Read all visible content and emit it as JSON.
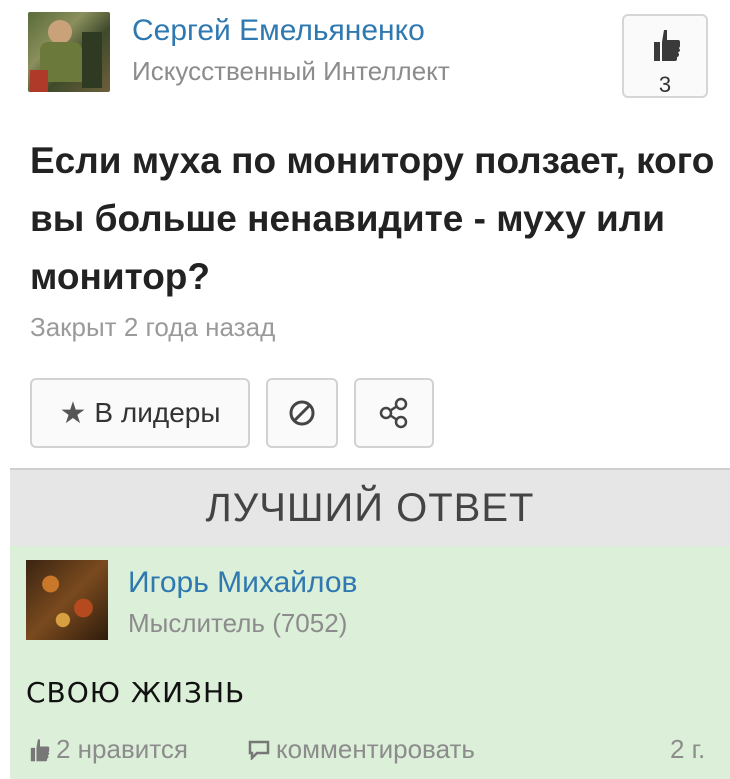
{
  "question": {
    "author_name": "Сергей Емельяненко",
    "author_rank": "Искусственный Интеллект",
    "like_count": "3",
    "title": "Если муха по монитору ползает, кого вы больше ненавидите - муху или монитор?",
    "status": "Закрыт 2 года назад",
    "actions": {
      "leader_label": "В лидеры",
      "leader_icon": "star-icon",
      "block_icon": "block-icon",
      "share_icon": "share-icon"
    }
  },
  "best_answer": {
    "header": "ЛУЧШИЙ ОТВЕТ",
    "author_name": "Игорь Михайлов",
    "author_rank": "Мыслитель (7052)",
    "text": "СВОЮ ЖИЗНЬ",
    "likes_label": "2 нравится",
    "comment_label": "комментировать",
    "age": "2 г."
  },
  "colors": {
    "link": "#2f79b0",
    "muted": "#8c8c8c",
    "answer_bg": "#dcefd8",
    "header_bg": "#e6e6e6"
  }
}
